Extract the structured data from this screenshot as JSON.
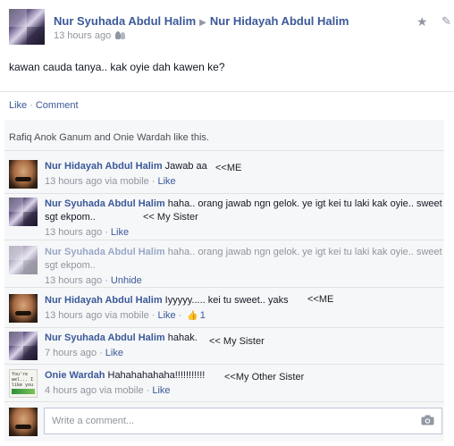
{
  "post": {
    "author": "Nur Syuhada Abdul Halim",
    "target": "Nur Hidayah Abdul Halim",
    "time": "13 hours ago",
    "text": "kawan cauda tanya.. kak oyie dah kawen ke?"
  },
  "actions": {
    "like": "Like",
    "comment": "Comment"
  },
  "likes_text": "Rafiq Anok Ganum and Onie Wardah like this.",
  "comments": [
    {
      "author": "Nur Hidayah Abdul Halim",
      "text": "Jawab aa",
      "meta_time": "13 hours ago via mobile",
      "meta_action": "Like",
      "annotation": "<<ME"
    },
    {
      "author": "Nur Syuhada Abdul Halim",
      "text": "haha.. orang jawab ngn gelok. ye igt kei tu laki kak oyie.. sweet sgt ekpom..",
      "meta_time": "13 hours ago",
      "meta_action": "Like",
      "annotation": "<< My Sister"
    },
    {
      "author": "Nur Syuhada Abdul Halim",
      "text": "haha.. orang jawab ngn gelok. ye igt kei tu laki kak oyie.. sweet sgt ekpom..",
      "meta_time": "13 hours ago",
      "meta_action": "Unhide"
    },
    {
      "author": "Nur Hidayah Abdul Halim",
      "text": "Iyyyyy..... kei tu sweet.. yaks",
      "meta_time": "13 hours ago via mobile",
      "meta_action": "Like",
      "like_count": "1",
      "annotation": "<<ME"
    },
    {
      "author": "Nur Syuhada Abdul Halim",
      "text": "hahak.",
      "meta_time": "7 hours ago",
      "meta_action": "Like",
      "annotation": "<< My Sister"
    },
    {
      "author": "Onie Wardah",
      "text": "Hahahahahaha!!!!!!!!!!!",
      "meta_time": "4 hours ago via mobile",
      "meta_action": "Like",
      "annotation": "<<My Other Sister"
    }
  ],
  "avatar_note_text": "You're wel... I like you",
  "composer": {
    "placeholder": "Write a comment..."
  },
  "icons": {
    "star": "star-icon",
    "pencil": "pencil-icon",
    "friends": "friends-icon",
    "camera": "camera-icon",
    "thumb": "thumbs-up-icon"
  },
  "colors": {
    "link": "#3b5998",
    "muted": "#90949c",
    "ufi_bg": "#f6f7f9"
  }
}
